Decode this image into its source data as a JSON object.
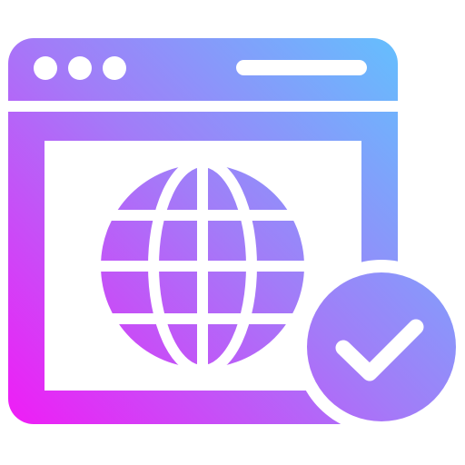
{
  "icon": {
    "name": "verified-website-icon",
    "parts": [
      "browser-window-icon",
      "window-control-dots-icon",
      "address-bar-icon",
      "globe-icon",
      "checkmark-badge-icon"
    ]
  },
  "colors": {
    "gradient_start": "#f01cf6",
    "gradient_mid": "#a27cf8",
    "gradient_end": "#5cc8fe",
    "background": "#ffffff"
  }
}
